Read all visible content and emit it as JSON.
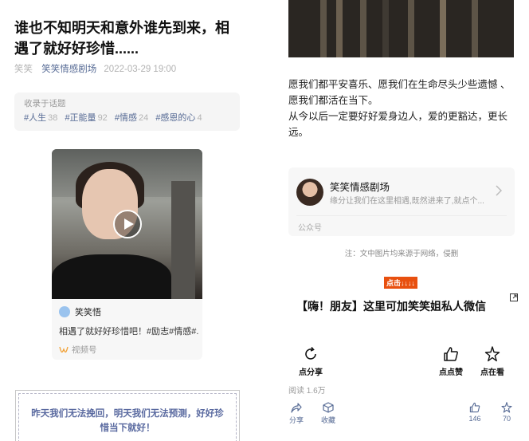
{
  "article": {
    "title": "谁也不知明天和意外谁先到来，相遇了就好好珍惜......",
    "author": "笑笑",
    "account": "笑笑情感剧场",
    "date": "2022-03-29 19:00"
  },
  "topics": {
    "label": "收录于话题",
    "items": [
      {
        "name": "#人生",
        "count": "38"
      },
      {
        "name": "#正能量",
        "count": "92"
      },
      {
        "name": "#情感",
        "count": "24"
      },
      {
        "name": "#感恩的心",
        "count": "4"
      }
    ]
  },
  "video": {
    "author": "笑笑悟",
    "desc": "相遇了就好好珍惜吧！#励志#情感#...",
    "source": "视频号",
    "play_icon": "play-icon"
  },
  "quote": {
    "text": "昨天我们无法挽回，明天我们无法预测，好好珍惜当下就好！"
  },
  "body": {
    "p1": "愿我们都平安喜乐、愿我们在生命尽头少些遗憾 、愿我们都活在当下。",
    "p2": "从今以后一定要好好爱身边人，爱的更豁达，更长远。"
  },
  "profile": {
    "name": "笑笑情感剧场",
    "desc": "缘分让我们在这里相遇,既然进来了,就点个...",
    "type": "公众号"
  },
  "note": "注：文中图片均来源于网络，侵删",
  "click_label": "点击↓↓↓↓",
  "heading": "【嗨！朋友】这里可加笑笑姐私人微信",
  "actions": {
    "share": "点分享",
    "like": "点点赞",
    "watch": "点在看"
  },
  "stats": {
    "reads": "阅读 1.6万",
    "share": "分享",
    "fav": "收藏",
    "likes": "146",
    "watching": "70"
  },
  "colors": {
    "link": "#576b95",
    "accent": "#e8500f"
  }
}
